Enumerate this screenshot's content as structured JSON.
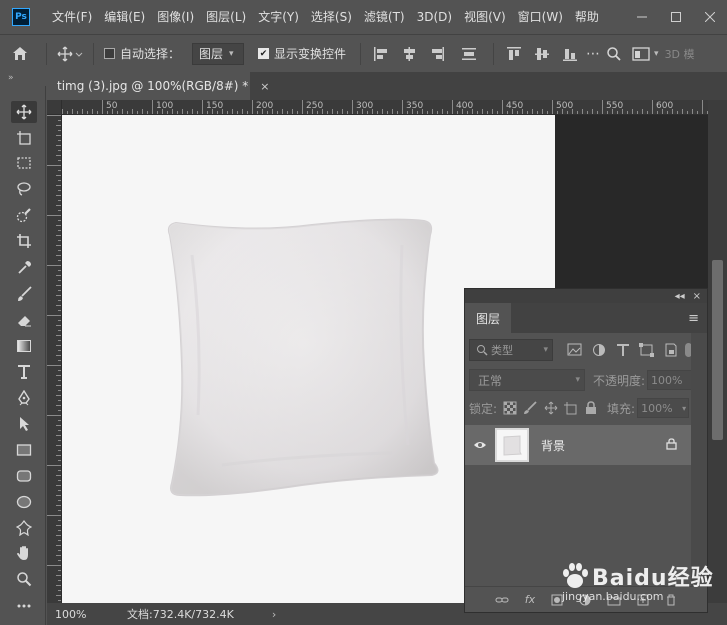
{
  "app": {
    "logo_text": "Ps"
  },
  "menu": [
    "文件(F)",
    "编辑(E)",
    "图像(I)",
    "图层(L)",
    "文字(Y)",
    "选择(S)",
    "滤镜(T)",
    "3D(D)",
    "视图(V)",
    "窗口(W)",
    "帮助"
  ],
  "options": {
    "auto_select_label": "自动选择：",
    "auto_select_value": "图层",
    "show_transform_label": "显示变换控件",
    "mode_3d": "3D 模"
  },
  "document": {
    "tab_title": "timg (3).jpg @ 100%(RGB/8#) *",
    "tab_close": "×"
  },
  "ruler": {
    "h_labels": [
      "50",
      "100",
      "150",
      "200",
      "250",
      "300",
      "350",
      "400",
      "450",
      "500",
      "550",
      "600"
    ]
  },
  "status": {
    "zoom": "100%",
    "doc_size": "文档:732.4K/732.4K",
    "arrow": "›"
  },
  "layers_panel": {
    "collapse": "◂◂",
    "close": "×",
    "tab_label": "图层",
    "filter_label": "类型",
    "blend_mode": "正常",
    "opacity_label": "不透明度:",
    "opacity_value": "100%",
    "lock_label": "锁定:",
    "fill_label": "填充:",
    "fill_value": "100%",
    "layer": {
      "name": "背景",
      "visible": true,
      "locked": true
    },
    "footer_icons": [
      "link-icon",
      "fx-icon",
      "mask-icon",
      "adjustment-icon",
      "folder-icon",
      "new-layer-icon",
      "trash-icon"
    ]
  },
  "watermark": {
    "text": "Baidu经验",
    "sub": "jingyan.baidu.com"
  },
  "colors": {
    "panel": "#535353",
    "canvas": "#f6f6f6",
    "pasteboard": "#282828",
    "accent": "#31a8ff"
  }
}
